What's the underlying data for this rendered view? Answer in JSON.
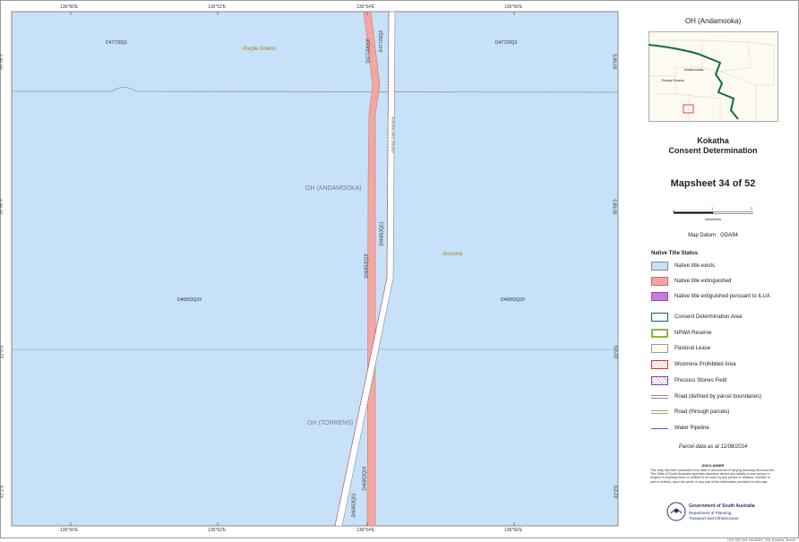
{
  "map": {
    "colors": {
      "native_title_exists": "#c7e1f9",
      "extinguished": "#f4a6a1",
      "extinguished_ilua": "#c57cdf",
      "consent_area": "#0b6a52",
      "npwa": "#8eb63f",
      "border": "#9a9a9a",
      "pipeline": "#4f5bd5",
      "road_parcel_line": "#8a8a8a",
      "road_through_parcels": "#a6a06a",
      "woomera": "#d63434",
      "precious": "#7a3fb3"
    },
    "lon_ticks": [
      "136°50'E",
      "136°52'E",
      "136°54'E",
      "136°56'E"
    ],
    "lat_ticks": [
      "30°56'S",
      "30°58'S",
      "31°0'S",
      "31°2'S"
    ],
    "parcels": [
      "D47720Q1",
      "D47720Q3",
      "D47720Q18",
      "D47720Q2",
      "D46853Q21",
      "D46853Q19",
      "D46853Q23",
      "D46853Q20",
      "D46853Q24",
      "D46853Q22"
    ],
    "places": {
      "purple_downs": "Purple Downs",
      "arcoona": "Arcoona"
    },
    "regions": {
      "andamooka": "OH (ANDAMOOKA)",
      "torrens": "OH (TORRENS)"
    },
    "road_label": "Olympic Dam Highway"
  },
  "panel": {
    "inset_title": "OH (Andamooka)",
    "inset_labels": {
      "roxby_downs": "Roxby Downs",
      "andamooka": "Andamooka"
    },
    "title_line1": "Kokatha",
    "title_line2": "Consent Determination",
    "mapsheet": "Mapsheet 34 of 52",
    "scale": {
      "ticks": [
        "0",
        "1",
        "2"
      ],
      "unit": "kilometres"
    },
    "datum": "Map Datum : GDA94",
    "legend_title": "Native Title Status",
    "legend": [
      {
        "label": "Native title exists"
      },
      {
        "label": "Native title extinguished"
      },
      {
        "label": "Native title extiguished pursuant to ILUA"
      },
      {
        "label": "Consent Determination Area"
      },
      {
        "label": "NPWA Reserve"
      },
      {
        "label": "Pastoral Lease"
      },
      {
        "label": "Woomera Prohibited Area"
      },
      {
        "label": "Precious Stones Field"
      },
      {
        "label": "Road (defined by parcel boundaries)"
      },
      {
        "label": "Road (through parcels)"
      },
      {
        "label": "Water Pipeline"
      }
    ],
    "parcel_date": "Parcel data as at 11/08/2014",
    "disclaimer_title": "DISCLAIMER",
    "disclaimer_text": "This map has been produced from data or documents of varying accuracy and sources. The State of South Australia expressly disclaims all and any liability to any person in respect of anything done or omitted to be done by any person in reliance, whether in part or entirely, upon the whole or any part of the information provided on this map.",
    "gov_line1": "Government of South Australia",
    "gov_line2": "Department of Planning,",
    "gov_line3": "Transport and Infrastructure",
    "footer": "LSG GIS Unit: 20140807_030_Kokatha_Tenure"
  }
}
